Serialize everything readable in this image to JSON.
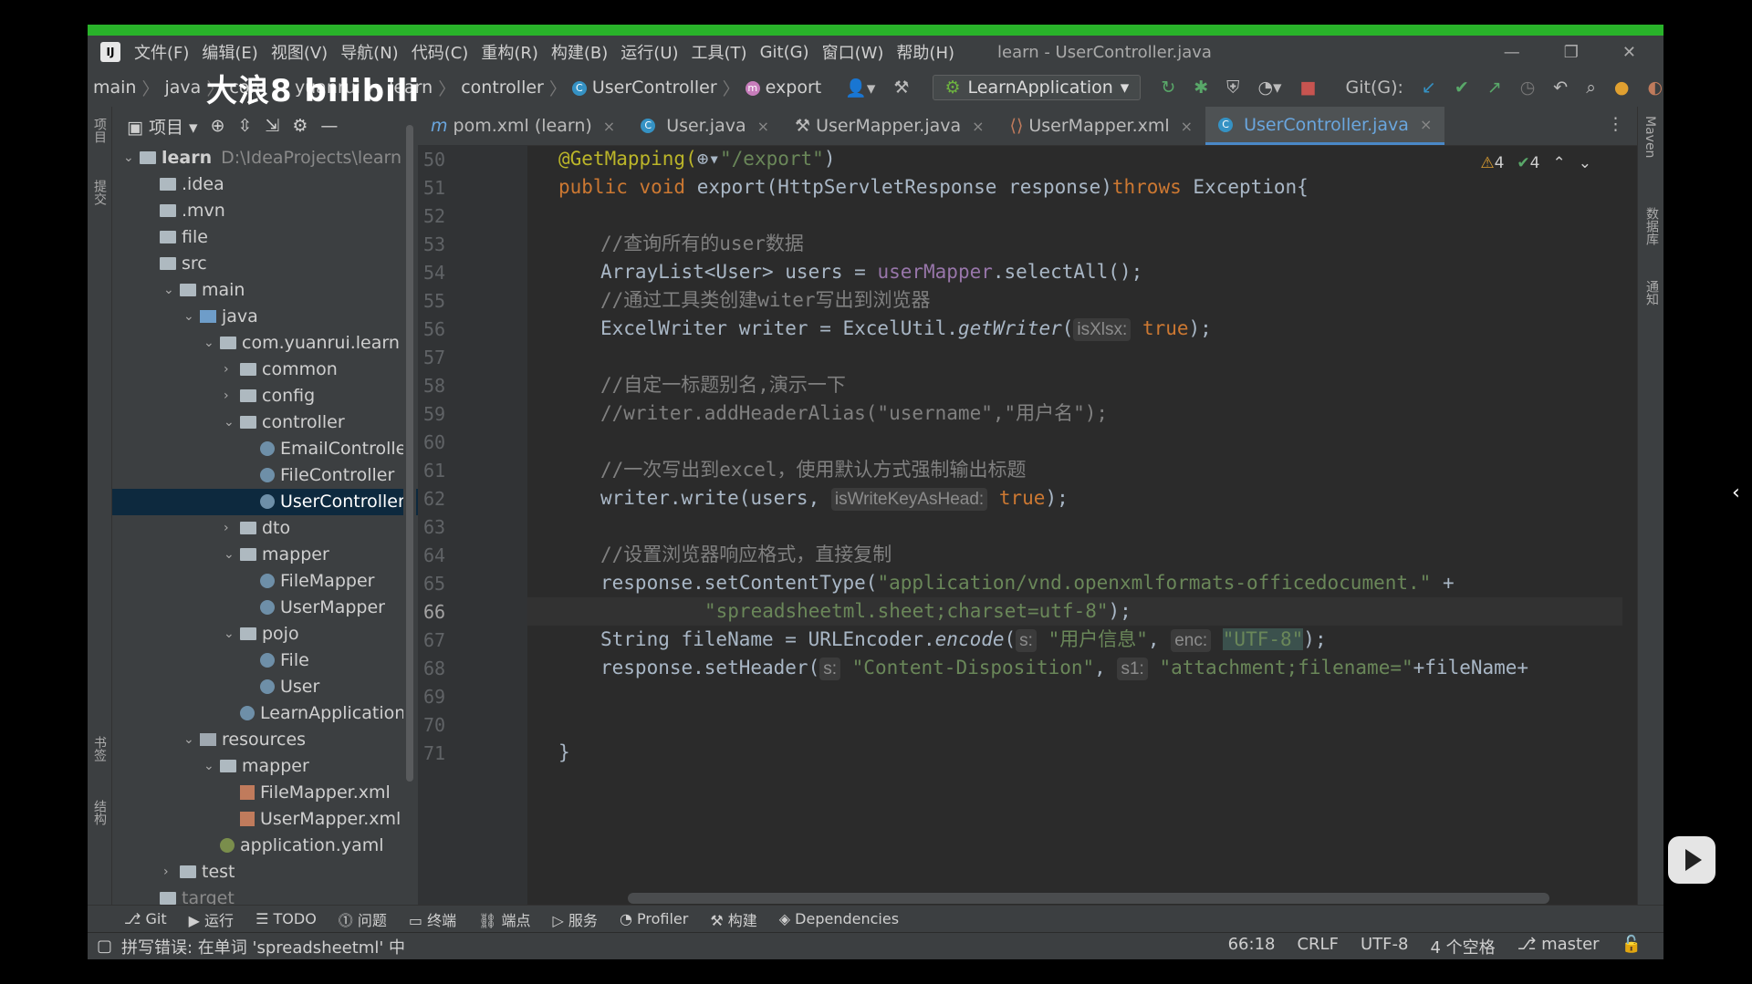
{
  "watermark": "大浪8 bilibili",
  "menu": [
    "文件(F)",
    "编辑(E)",
    "视图(V)",
    "导航(N)",
    "代码(C)",
    "重构(R)",
    "构建(B)",
    "运行(U)",
    "工具(T)",
    "Git(G)",
    "窗口(W)",
    "帮助(H)"
  ],
  "window_title": "learn - UserController.java",
  "breadcrumbs": [
    "main",
    "java",
    "com",
    "yuanrui",
    "learn",
    "controller",
    "UserController",
    "export"
  ],
  "run_config": "LearnApplication",
  "git_label": "Git(G):",
  "project_panel": {
    "title": "项目"
  },
  "left_tools": [
    "项目",
    "提交",
    "书签",
    "结构"
  ],
  "right_tools": [
    "Maven",
    "数据库",
    "通知"
  ],
  "tree": [
    {
      "label": "learn",
      "extra": "D:\\IdeaProjects\\learn",
      "depth": 0,
      "icon": "folder",
      "arrow": "down"
    },
    {
      "label": ".idea",
      "depth": 1,
      "icon": "folder",
      "arrow": ""
    },
    {
      "label": ".mvn",
      "depth": 1,
      "icon": "folder",
      "arrow": ""
    },
    {
      "label": "file",
      "depth": 1,
      "icon": "folder",
      "arrow": ""
    },
    {
      "label": "src",
      "depth": 1,
      "icon": "folder",
      "arrow": ""
    },
    {
      "label": "main",
      "depth": 2,
      "icon": "folder",
      "arrow": "down"
    },
    {
      "label": "java",
      "depth": 3,
      "icon": "fblue",
      "arrow": "down"
    },
    {
      "label": "com.yuanrui.learn",
      "depth": 4,
      "icon": "folder",
      "arrow": "down"
    },
    {
      "label": "common",
      "depth": 5,
      "icon": "folder",
      "arrow": "right"
    },
    {
      "label": "config",
      "depth": 5,
      "icon": "folder",
      "arrow": "right"
    },
    {
      "label": "controller",
      "depth": 5,
      "icon": "folder",
      "arrow": "down"
    },
    {
      "label": "EmailController",
      "depth": 6,
      "icon": "jclass",
      "arrow": ""
    },
    {
      "label": "FileController",
      "depth": 6,
      "icon": "jclass",
      "arrow": ""
    },
    {
      "label": "UserController",
      "depth": 6,
      "icon": "jclass",
      "arrow": "",
      "selected": true
    },
    {
      "label": "dto",
      "depth": 5,
      "icon": "folder",
      "arrow": "right"
    },
    {
      "label": "mapper",
      "depth": 5,
      "icon": "folder",
      "arrow": "down"
    },
    {
      "label": "FileMapper",
      "depth": 6,
      "icon": "jclass",
      "arrow": ""
    },
    {
      "label": "UserMapper",
      "depth": 6,
      "icon": "jclass",
      "arrow": ""
    },
    {
      "label": "pojo",
      "depth": 5,
      "icon": "folder",
      "arrow": "down"
    },
    {
      "label": "File",
      "depth": 6,
      "icon": "jclass",
      "arrow": ""
    },
    {
      "label": "User",
      "depth": 6,
      "icon": "jclass",
      "arrow": ""
    },
    {
      "label": "LearnApplication",
      "depth": 5,
      "icon": "jclass",
      "arrow": ""
    },
    {
      "label": "resources",
      "depth": 3,
      "icon": "fres",
      "arrow": "down"
    },
    {
      "label": "mapper",
      "depth": 4,
      "icon": "folder",
      "arrow": "down"
    },
    {
      "label": "FileMapper.xml",
      "depth": 5,
      "icon": "xmlic",
      "arrow": ""
    },
    {
      "label": "UserMapper.xml",
      "depth": 5,
      "icon": "xmlic",
      "arrow": ""
    },
    {
      "label": "application.yaml",
      "depth": 4,
      "icon": "yamlic",
      "arrow": ""
    },
    {
      "label": "test",
      "depth": 2,
      "icon": "folder",
      "arrow": "right"
    },
    {
      "label": "target",
      "depth": 1,
      "icon": "folder",
      "arrow": "",
      "dim": true
    }
  ],
  "tabs": [
    {
      "label": "pom.xml (learn)",
      "icon": "m",
      "active": false
    },
    {
      "label": "User.java",
      "icon": "c",
      "active": false
    },
    {
      "label": "UserMapper.java",
      "icon": "i",
      "active": false
    },
    {
      "label": "UserMapper.xml",
      "icon": "x",
      "active": false
    },
    {
      "label": "UserController.java",
      "icon": "c",
      "active": true
    }
  ],
  "inspections": {
    "warnings": "4",
    "ok": "4"
  },
  "line_numbers": [
    "50",
    "51",
    "52",
    "53",
    "54",
    "55",
    "56",
    "57",
    "58",
    "59",
    "60",
    "61",
    "62",
    "63",
    "64",
    "65",
    "66",
    "67",
    "68",
    "69",
    "70",
    "71"
  ],
  "current_line": "66",
  "code": {
    "l50_ann": "@GetMapping(",
    "l50_str": "\"/export\"",
    "l50_end": ")",
    "l51_kw1": "public void ",
    "l51_a": "export(HttpServletResponse response)",
    "l51_kw2": "throws ",
    "l51_b": "Exception{",
    "l53_cm": "//查询所有的user数据",
    "l54_a": "ArrayList<User> users = ",
    "l54_fld": "userMapper",
    "l54_b": ".selectAll();",
    "l55_cm": "//通过工具类创建witer写出到浏览器",
    "l56_a": "ExcelWriter writer = ExcelUtil.",
    "l56_it": "getWriter",
    "l56_b": "(",
    "l56_hint": "isXlsx:",
    "l56_kw": "true",
    "l56_c": ");",
    "l58_cm": "//自定一标题别名,演示一下",
    "l59_cm": "//writer.addHeaderAlias(\"username\",\"用户名\");",
    "l61_cm": "//一次写出到excel，使用默认方式强制输出标题",
    "l62_a": "writer.write(users, ",
    "l62_hint": "isWriteKeyAsHead:",
    "l62_kw": "true",
    "l62_b": ");",
    "l64_cm": "//设置浏览器响应格式，直接复制",
    "l65_a": "response.setContentType(",
    "l65_str": "\"application/vnd.openxmlformats-officedocument.\"",
    "l65_b": " +",
    "l66_str": "\"spreadsheetml.sheet;charset=utf-8\"",
    "l66_b": ");",
    "l67_a": "String fileName = URLEncoder.",
    "l67_it": "encode",
    "l67_b": "(",
    "l67_hint1": "s:",
    "l67_str1": "\"用户信息\"",
    "l67_c": ", ",
    "l67_hint2": "enc:",
    "l67_str2": "\"UTF-8\"",
    "l67_d": ");",
    "l68_a": "response.setHeader(",
    "l68_hint1": "s:",
    "l68_str1": "\"Content-Disposition\"",
    "l68_c": ", ",
    "l68_hint2": "s1:",
    "l68_str2": "\"attachment;filename=\"",
    "l68_d": "+fileName+",
    "l71_a": "}"
  },
  "bottom_tools": [
    "Git",
    "运行",
    "TODO",
    "问题",
    "终端",
    "端点",
    "服务",
    "Profiler",
    "构建",
    "Dependencies"
  ],
  "status": {
    "message": "拼写错误: 在单词 'spreadsheetml' 中",
    "position": "66:18",
    "line_sep": "CRLF",
    "encoding": "UTF-8",
    "indent": "4 个空格",
    "branch": "master"
  }
}
